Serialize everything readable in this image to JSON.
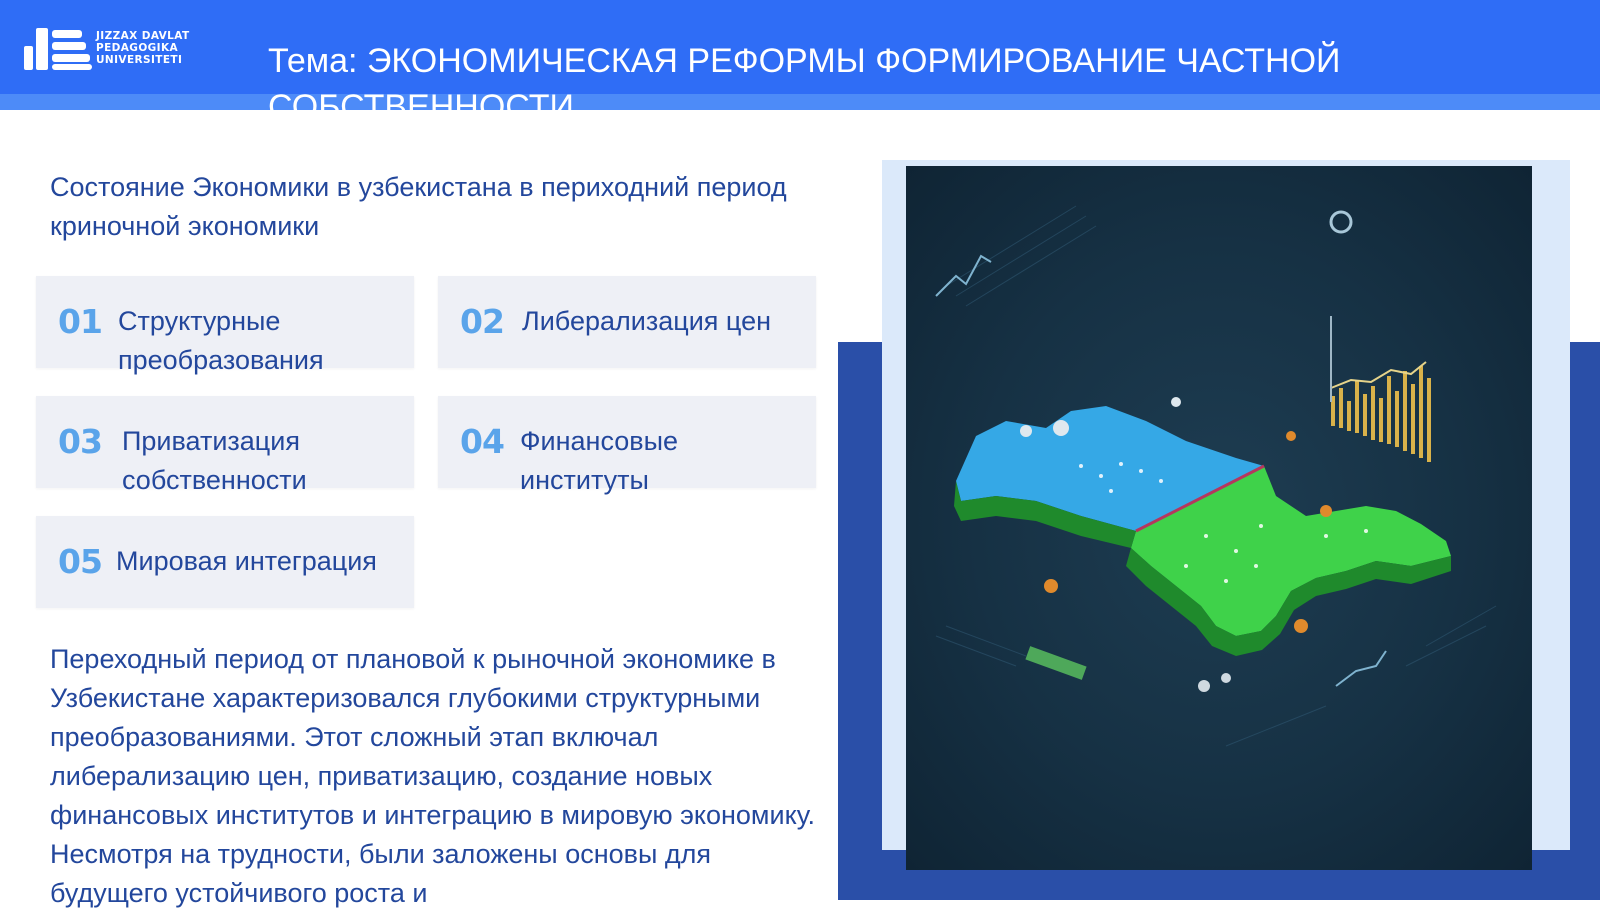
{
  "header": {
    "logo_lines": [
      "JIZZAX DAVLAT",
      "PEDAGOGIKA",
      "UNIVERSITETI"
    ],
    "title": "Тема: ЭКОНОМИЧЕСКАЯ  РЕФОРМЫ ФОРМИРОВАНИЕ  ЧАСТНОЙ СОБСТВЕННОСТИ"
  },
  "subtitle": "Состояние Экономики в узбекистана в периходний период криночной экономики",
  "cards": [
    {
      "num": "01",
      "label": "Структурные преобразования"
    },
    {
      "num": "02",
      "label": "Либерализация цен"
    },
    {
      "num": "03",
      "label": "Приватизация собственности"
    },
    {
      "num": "04",
      "label": "Финансовые институты"
    },
    {
      "num": "05",
      "label": "Мировая интеграция"
    }
  ],
  "paragraph": "Переходный период от плановой к рыночной экономике в Узбекистане характеризовался глубокими структурными преобразованиями. Этот сложный этап включал либерализацию цен, приватизацию, создание новых финансовых институтов и интеграцию в мировую экономику. Несмотря на трудности, были заложены основы для будущего устойчивого роста и",
  "colors": {
    "header": "#2f6df6",
    "text": "#23479c",
    "number": "#5aa4ea",
    "card": "#eef0f6",
    "map_green": "#3fd24a",
    "map_blue": "#35a8e6"
  },
  "illustration": {
    "icon": "uzbekistan-map-icon"
  }
}
